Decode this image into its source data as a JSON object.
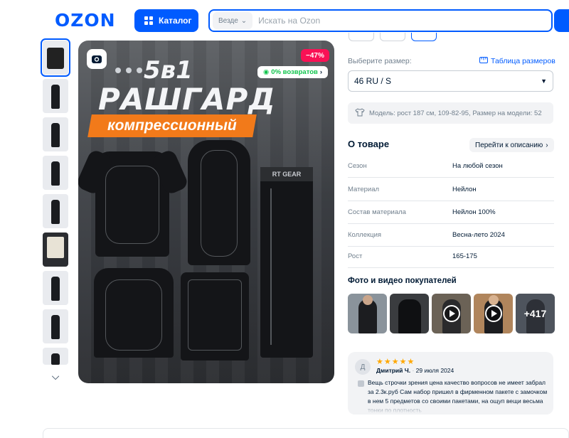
{
  "header": {
    "logo": "OZON",
    "catalog_label": "Каталог",
    "search_scope": "Везде",
    "search_placeholder": "Искать на Ozon"
  },
  "gallery": {
    "thumbnail_count": 9,
    "hero": {
      "title_line1": "5в1",
      "title_line2": "РАШГАРД",
      "subtitle": "компрессионный",
      "tights_band_text": "RT GEAR",
      "discount_badge": "−47%",
      "cashback_badge": "0% возвратов"
    }
  },
  "product": {
    "size_label": "Выберите размер:",
    "size_table_link": "Таблица размеров",
    "selected_size": "46 RU / S",
    "model_info": "Модель: рост 187 см, 109-82-95, Размер на модели: 52",
    "about_title": "О товаре",
    "go_to_description": "Перейти к описанию",
    "specs": [
      {
        "key": "Сезон",
        "value": "На любой сезон"
      },
      {
        "key": "Материал",
        "value": "Нейлон"
      },
      {
        "key": "Состав материала",
        "value": "Нейлон 100%"
      },
      {
        "key": "Коллекция",
        "value": "Весна-лето 2024"
      },
      {
        "key": "Рост",
        "value": "165-175"
      }
    ],
    "customer_media_title": "Фото и видео покупателей",
    "customer_media_more": "+417",
    "review": {
      "avatar_letter": "Д",
      "stars": "★★★★★",
      "author": "Дмитрий Ч.",
      "date": "29 июля 2024",
      "text": "Вещь строчки зрения цена качество вопросов не имеет забрал за 2.3к.руб Сам набор пришел в фирменном пакете с замочком в нем 5 предметов со своими пакетами, на ощуп вещи весьма тонки по плотность"
    }
  },
  "colors": {
    "brand": "#005bff",
    "discount": "#f91155",
    "cashback": "#10c44c",
    "ribbon": "#f27a1a",
    "stars": "#ffa800"
  }
}
